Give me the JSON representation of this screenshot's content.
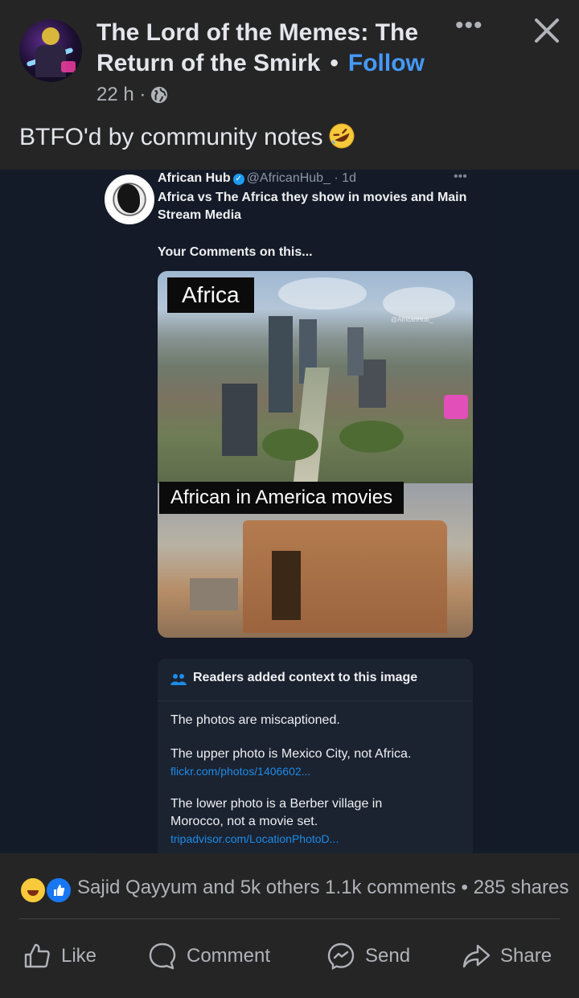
{
  "post": {
    "page_name": "The Lord of the Memes: The Return of the Smirk",
    "follow_label": "Follow",
    "separator": "•",
    "time": "22 h ·",
    "more_label": "•••",
    "caption": "BTFO'd by community notes"
  },
  "tweet": {
    "name": "African Hub",
    "handle": "@AfricanHub_ · 1d",
    "more": "•••",
    "text": "Africa vs The Africa they show in movies and Main Stream Media",
    "subtext": "Your Comments on this...",
    "label_top": "Africa",
    "label_bottom": "African in America movies",
    "watermark": "@AfricanHub_"
  },
  "community_note": {
    "title": "Readers added context to this image",
    "line1": "The photos are miscaptioned.",
    "line2": "The upper photo is Mexico City, not Africa.",
    "link1": "flickr.com/photos/1406602...",
    "line3": "The lower photo is a Berber village in Morocco, not a movie set.",
    "link2": "tripadvisor.com/LocationPhotoD..."
  },
  "engagement": {
    "summary": "Sajid Qayyum and 5k others  1.1k comments • 285 shares"
  },
  "actions": {
    "like": "Like",
    "comment": "Comment",
    "send": "Send",
    "share": "Share"
  },
  "colors": {
    "background": "#252526",
    "accent": "#4599ff",
    "secondary_text": "#b0b3b8"
  }
}
